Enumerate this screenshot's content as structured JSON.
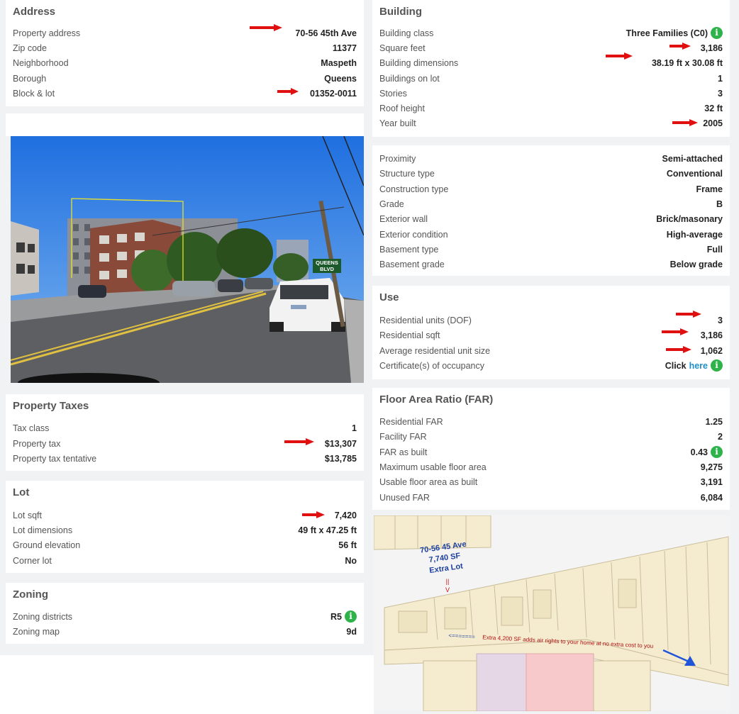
{
  "address": {
    "title": "Address",
    "rows": [
      {
        "label": "Property address",
        "value": "70-56 45th Ave"
      },
      {
        "label": "Zip code",
        "value": "11377"
      },
      {
        "label": "Neighborhood",
        "value": "Maspeth"
      },
      {
        "label": "Borough",
        "value": "Queens"
      },
      {
        "label": "Block & lot",
        "value": "01352-0011"
      }
    ]
  },
  "building": {
    "title": "Building",
    "rows": [
      {
        "label": "Building class",
        "value": "Three Families (C0)"
      },
      {
        "label": "Square feet",
        "value": "3,186"
      },
      {
        "label": "Building dimensions",
        "value": "38.19 ft x 30.08 ft"
      },
      {
        "label": "Buildings on lot",
        "value": "1"
      },
      {
        "label": "Stories",
        "value": "3"
      },
      {
        "label": "Roof height",
        "value": "32 ft"
      },
      {
        "label": "Year built",
        "value": "2005"
      }
    ]
  },
  "structure": {
    "rows": [
      {
        "label": "Proximity",
        "value": "Semi-attached"
      },
      {
        "label": "Structure type",
        "value": "Conventional"
      },
      {
        "label": "Construction type",
        "value": "Frame"
      },
      {
        "label": "Grade",
        "value": "B"
      },
      {
        "label": "Exterior wall",
        "value": "Brick/masonary"
      },
      {
        "label": "Exterior condition",
        "value": "High-average"
      },
      {
        "label": "Basement type",
        "value": "Full"
      },
      {
        "label": "Basement grade",
        "value": "Below grade"
      }
    ]
  },
  "use": {
    "title": "Use",
    "rows": [
      {
        "label": "Residential units (DOF)",
        "value": "3"
      },
      {
        "label": "Residential sqft",
        "value": "3,186"
      },
      {
        "label": "Average residential unit size",
        "value": "1,062"
      },
      {
        "label": "Certificate(s) of occupancy",
        "value": "Click",
        "link": "here"
      }
    ]
  },
  "far": {
    "title": "Floor Area Ratio (FAR)",
    "rows": [
      {
        "label": "Residential FAR",
        "value": "1.25"
      },
      {
        "label": "Facility FAR",
        "value": "2"
      },
      {
        "label": "FAR as built",
        "value": "0.43"
      },
      {
        "label": "Maximum usable floor area",
        "value": "9,275"
      },
      {
        "label": "Usable floor area as built",
        "value": "3,191"
      },
      {
        "label": "Unused FAR",
        "value": "6,084"
      }
    ]
  },
  "taxes": {
    "title": "Property Taxes",
    "rows": [
      {
        "label": "Tax class",
        "value": "1"
      },
      {
        "label": "Property tax",
        "value": "$13,307"
      },
      {
        "label": "Property tax tentative",
        "value": "$13,785"
      }
    ]
  },
  "lot": {
    "title": "Lot",
    "rows": [
      {
        "label": "Lot sqft",
        "value": "7,420"
      },
      {
        "label": "Lot dimensions",
        "value": "49 ft x 47.25 ft"
      },
      {
        "label": "Ground elevation",
        "value": "56 ft"
      },
      {
        "label": "Corner lot",
        "value": "No"
      }
    ]
  },
  "zoning": {
    "title": "Zoning",
    "rows": [
      {
        "label": "Zoning districts",
        "value": "R5"
      },
      {
        "label": "Zoning map",
        "value": "9d"
      }
    ]
  },
  "photo": {
    "sign_line1": "QUEENS",
    "sign_line2": "BLVD"
  },
  "map": {
    "annotation_line1": "70-56 45 Ave",
    "annotation_line2": "7,740 SF",
    "annotation_line3": "Extra Lot",
    "down_marker": "||\nV",
    "note_arrow": "<=======",
    "note": "Extra 4,200 SF adds air rights to your home at no extra cost to you"
  },
  "icons": {
    "info": "info-icon",
    "red_arrow": "red-arrow-icon",
    "blue_arrow": "blue-arrow-icon"
  },
  "colors": {
    "info_green": "#2eb34b",
    "link_blue": "#1f8fc9",
    "arrow_red": "#e01010",
    "map_parcel": "#f5ecd0"
  }
}
